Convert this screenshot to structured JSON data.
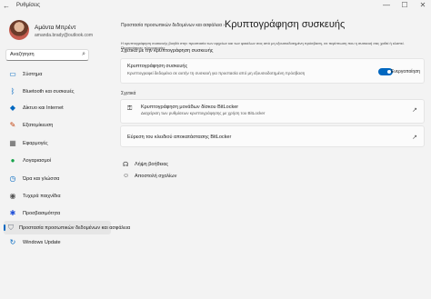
{
  "window": {
    "title": "Ρυθμίσεις",
    "back_icon": "back-arrow-icon",
    "controls": [
      "—",
      "☐",
      "✕"
    ]
  },
  "profile": {
    "name": "Αμάντα Μπρέντ",
    "email": "amanda.brady@outlook.com"
  },
  "search": {
    "value": "Αναζήτηση",
    "icon": "search-icon"
  },
  "sidebar": {
    "items": [
      {
        "label": "Σύστημα",
        "icon": "monitor-icon",
        "color": "#0067c0"
      },
      {
        "label": "Bluetooth και συσκευές",
        "icon": "bluetooth-icon",
        "color": "#0067c0"
      },
      {
        "label": "Δίκτυο και Internet",
        "icon": "wifi-icon",
        "color": "#0067c0"
      },
      {
        "label": "Εξατομίκευση",
        "icon": "brush-icon",
        "color": "#c2410c"
      },
      {
        "label": "Εφαρμογές",
        "icon": "apps-icon",
        "color": "#5a5a5a"
      },
      {
        "label": "Λογαριασμοί",
        "icon": "account-icon",
        "color": "#16a34a"
      },
      {
        "label": "Ώρα και γλώσσα",
        "icon": "globe-clock-icon",
        "color": "#0067c0"
      },
      {
        "label": "Τυχερά παιχνίδια",
        "icon": "gamepad-icon",
        "color": "#555555"
      },
      {
        "label": "Προσβασιμότητα",
        "icon": "accessibility-icon",
        "color": "#1d4ed8"
      },
      {
        "label": "Προστασία προσωπικών δεδομένων και ασφάλεια",
        "icon": "shield-icon",
        "color": "#6b7280"
      },
      {
        "label": "Windows Update",
        "icon": "update-icon",
        "color": "#0067c0"
      }
    ],
    "active_index": 9
  },
  "main": {
    "breadcrumb": "Προστασία προσωπικών δεδομένων και ασφάλεια",
    "breadcrumb_sep": "›",
    "title": "Κρυπτογράφηση συσκευής",
    "description": "Η κρυπτογράφηση συσκευής βοηθά στην προστασία των αρχείων και των φακέλων σας από μη εξουσιοδοτημένη πρόσβαση, σε περίπτωση που η συσκευή σας χαθεί ή κλαπεί. Περισσότερες πληροφορίες",
    "section_heading": "Σχετικά με την κρυπτογράφηση συσκευής",
    "encryption_card": {
      "title": "Κρυπτογράφηση συσκευής",
      "subtitle": "Κρυπτογραφεί δεδομένα σε αυτήν τη συσκευή για προστασία από μη εξουσιοδοτημένη πρόσβαση",
      "toggle_state": true,
      "toggle_label": "Ενεργοποίηση"
    },
    "related_heading": "Σχετικά",
    "related": [
      {
        "title": "Κρυπτογράφηση μονάδων δίσκου BitLocker",
        "subtitle": "Διαχείριση των ρυθμίσεων κρυπτογράφησης με χρήση του BitLocker",
        "icon": "key-icon"
      },
      {
        "title": "Εύρεση του κλειδιού αποκατάστασης BitLocker",
        "subtitle": "",
        "icon": ""
      }
    ],
    "help_links": [
      {
        "label": "Λήψη βοήθειας",
        "icon": "help-icon"
      },
      {
        "label": "Αποστολή σχολίων",
        "icon": "feedback-icon"
      }
    ]
  }
}
